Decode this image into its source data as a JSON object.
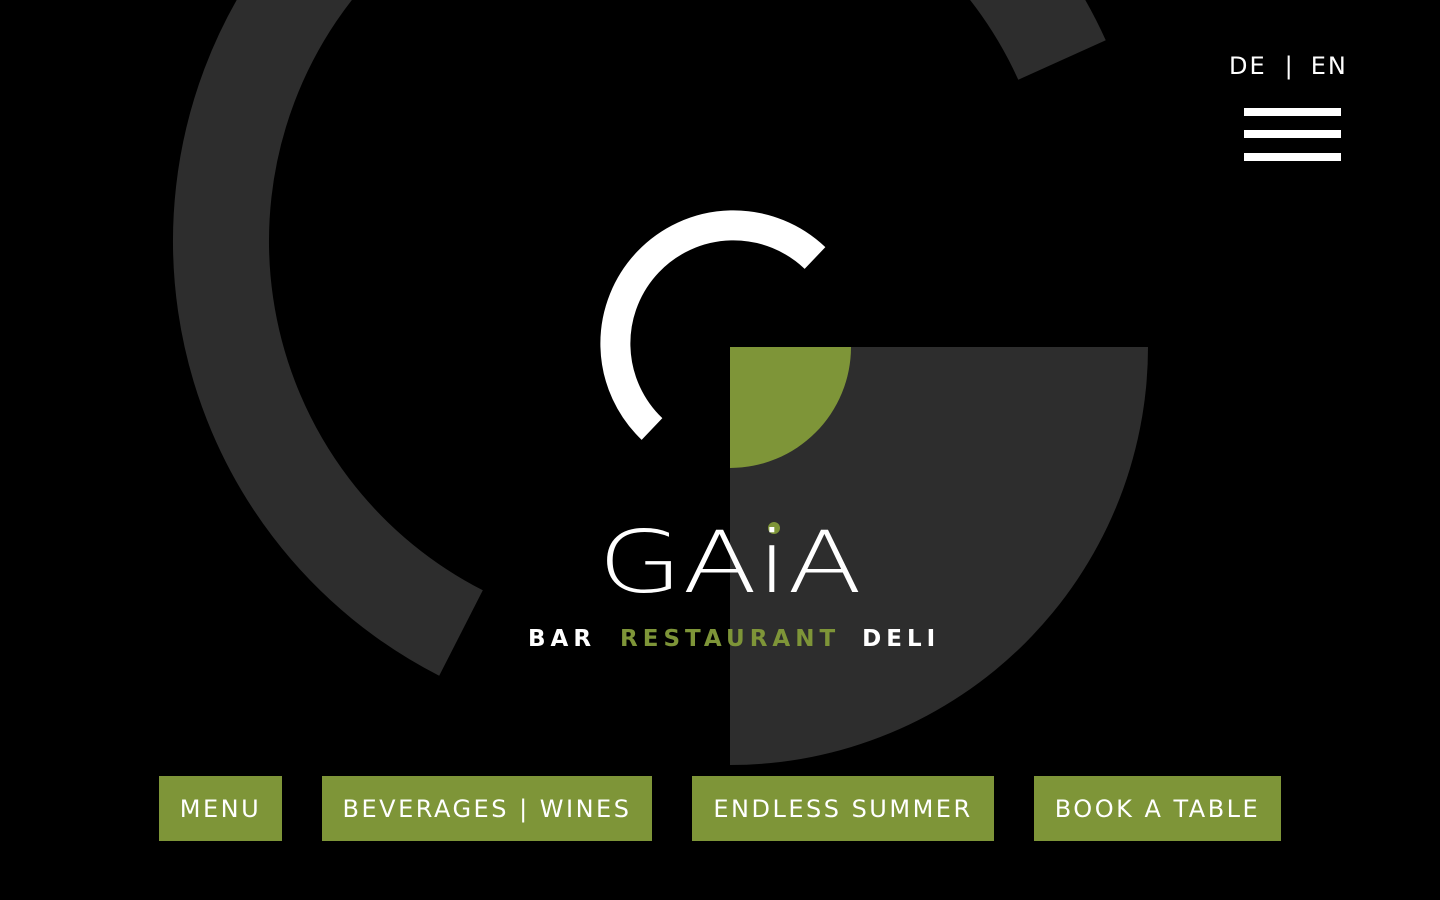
{
  "header": {
    "lang_de": "DE",
    "lang_separator": "|",
    "lang_en": "EN",
    "menu_icon": "hamburger-icon"
  },
  "brand": {
    "logo_name": "GAiA",
    "tagline_bar": "BAR",
    "tagline_restaurant": "RESTAURANT",
    "tagline_deli": "DELI"
  },
  "nav": {
    "menu_label": "MENU",
    "beverages_label": "BEVERAGES | WINES",
    "summer_label": "ENDLESS SUMMER",
    "book_label": "BOOK A TABLE"
  },
  "colors": {
    "background": "#000000",
    "accent_green": "#7e9538",
    "dark_gray": "#2d2d2d",
    "text_white": "#ffffff"
  }
}
